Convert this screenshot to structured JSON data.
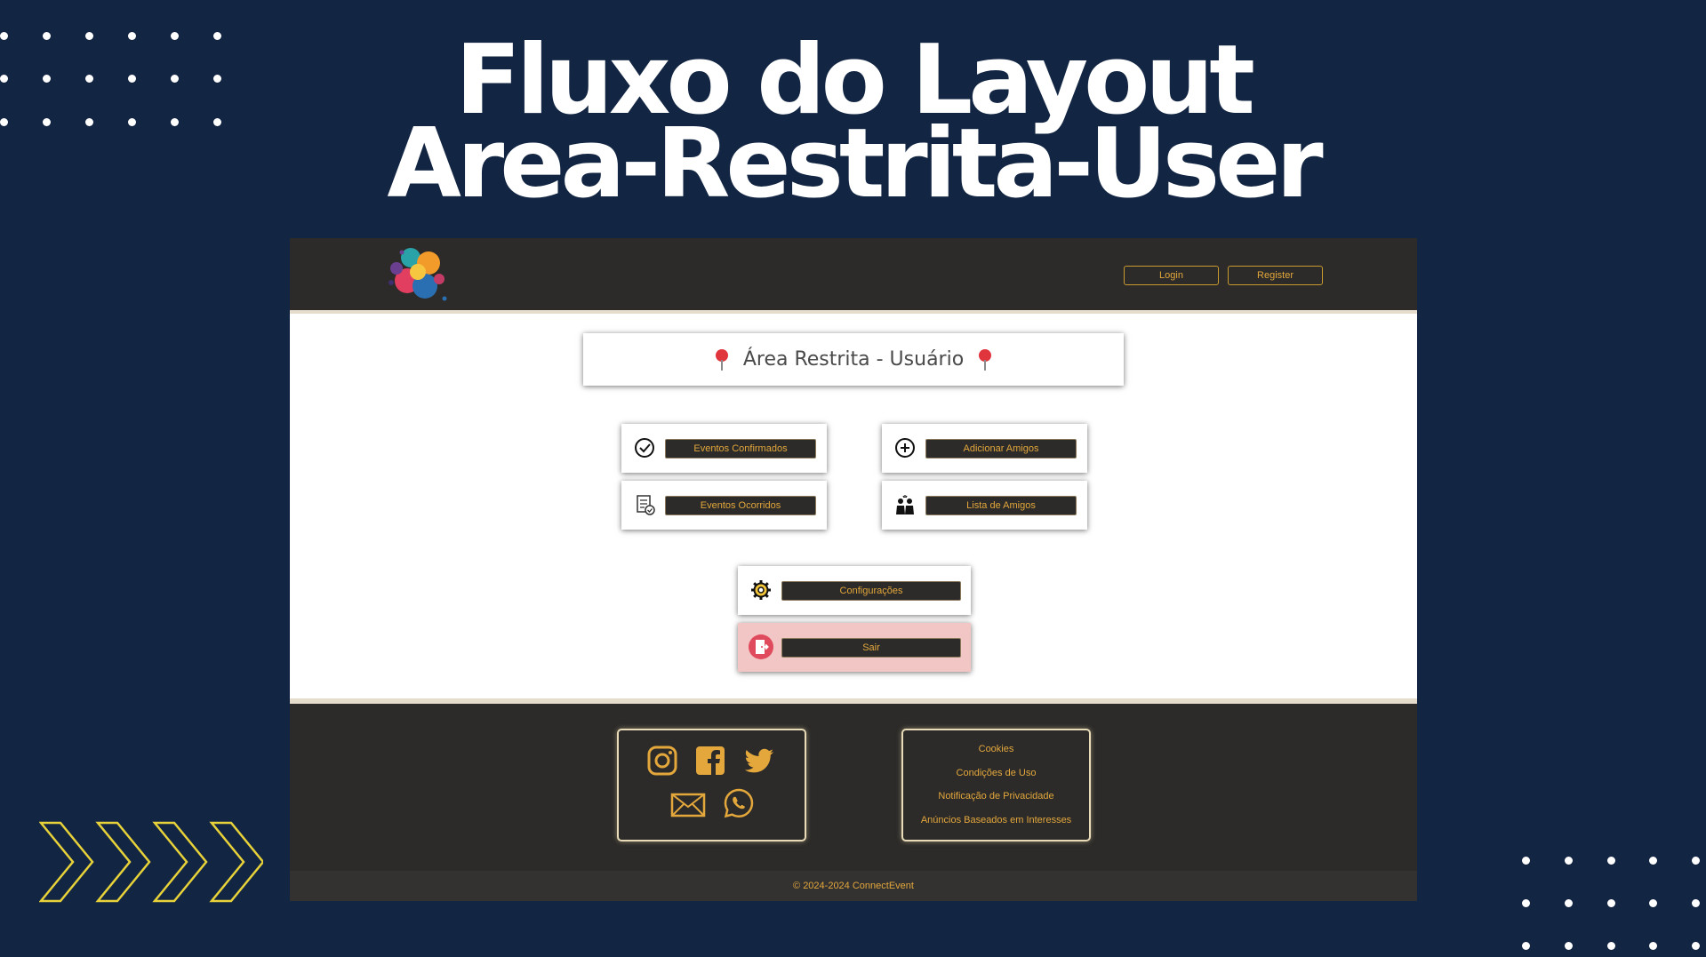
{
  "slide": {
    "title_line1": "Fluxo do Layout",
    "title_line2": "Area-Restrita-User"
  },
  "colors": {
    "background": "#122543",
    "accent": "#e3a73c",
    "panel": "#2c2b29",
    "danger_card": "#f3c6c6",
    "chevron": "#e8d23a"
  },
  "header": {
    "logo": "connectevent-logo",
    "login_label": "Login",
    "register_label": "Register"
  },
  "main": {
    "title": "Área Restrita - Usuário",
    "title_icon": "map-pin-icon",
    "actions": [
      {
        "label": "Eventos Confirmados",
        "icon": "check-circle-icon"
      },
      {
        "label": "Adicionar Amigos",
        "icon": "plus-circle-icon"
      },
      {
        "label": "Eventos Ocorridos",
        "icon": "document-check-icon"
      },
      {
        "label": "Lista de Amigos",
        "icon": "friends-icon"
      },
      {
        "label": "Configurações",
        "icon": "gear-icon"
      },
      {
        "label": "Sair",
        "icon": "exit-door-icon"
      }
    ]
  },
  "footer": {
    "social_icons": [
      "instagram-icon",
      "facebook-icon",
      "twitter-icon",
      "email-icon",
      "whatsapp-icon"
    ],
    "links": [
      "Cookies",
      "Condições de Uso",
      "Notificação de Privacidade",
      "Anúncios Baseados em Interesses"
    ],
    "copyright": "© 2024-2024 ConnectEvent"
  }
}
